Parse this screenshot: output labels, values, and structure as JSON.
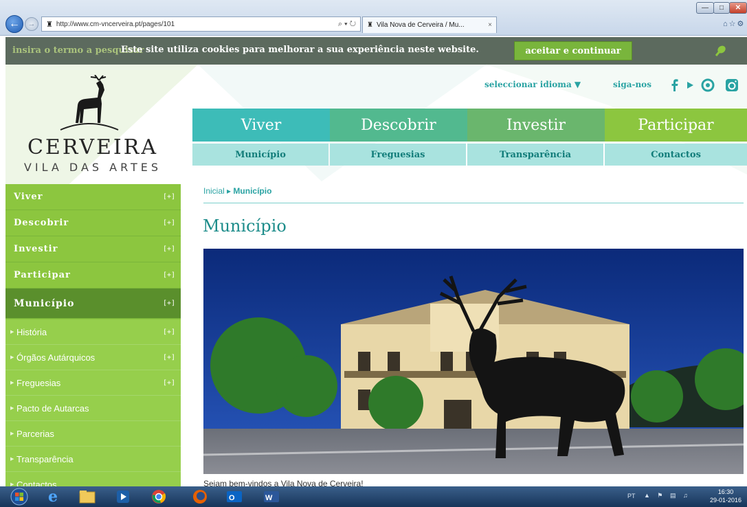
{
  "browser": {
    "address_url": "http://www.cm-vncerveira.pt/pages/101",
    "address_controls": "⌕ ▾ ↻",
    "tab_title": "Vila Nova de Cerveira / Mu...",
    "tab_close": "×"
  },
  "cookie_bar": {
    "search_placeholder": "insira o termo a pesquisar",
    "message": "Este site utiliza cookies para melhorar a sua experiência neste website.",
    "accept_label": "aceitar e continuar"
  },
  "header": {
    "logo_name": "CERVEIRA",
    "logo_tagline": "VILA DAS ARTES",
    "language_label": "seleccionar idioma ▼",
    "follow_label": "siga-nos"
  },
  "main_nav": [
    {
      "label": "Viver",
      "color": "#3dbcb8"
    },
    {
      "label": "Descobrir",
      "color": "#52b98f"
    },
    {
      "label": "Investir",
      "color": "#6ab66d"
    },
    {
      "label": "Participar",
      "color": "#8cc63f"
    }
  ],
  "sub_nav": [
    {
      "label": "Município"
    },
    {
      "label": "Freguesias"
    },
    {
      "label": "Transparência"
    },
    {
      "label": "Contactos"
    }
  ],
  "sidebar": {
    "top_items": [
      {
        "label": "Viver",
        "toggle": "[+]"
      },
      {
        "label": "Descobrir",
        "toggle": "[+]"
      },
      {
        "label": "Investir",
        "toggle": "[+]"
      },
      {
        "label": "Participar",
        "toggle": "[+]"
      }
    ],
    "active_item": {
      "label": "Município",
      "toggle": "[+]"
    },
    "sub_items": [
      {
        "label": "História",
        "toggle": "[+]"
      },
      {
        "label": "Órgãos Autárquicos",
        "toggle": "[+]"
      },
      {
        "label": "Freguesias",
        "toggle": "[+]"
      },
      {
        "label": "Pacto de Autarcas",
        "toggle": ""
      },
      {
        "label": "Parcerias",
        "toggle": ""
      },
      {
        "label": "Transparência",
        "toggle": ""
      },
      {
        "label": "Contactos",
        "toggle": ""
      }
    ]
  },
  "content": {
    "breadcrumb_home": "Inicial",
    "breadcrumb_sep": "▸",
    "breadcrumb_current": "Município",
    "title": "Município",
    "caption": "Sejam bem-vindos a Vila Nova de Cerveira!"
  },
  "taskbar": {
    "tray_lang": "PT",
    "time": "16:30",
    "date": "29-01-2016"
  },
  "colors": {
    "teal": "#2aa3a3",
    "green": "#8cc63f",
    "active_green": "#5a8f2c"
  }
}
